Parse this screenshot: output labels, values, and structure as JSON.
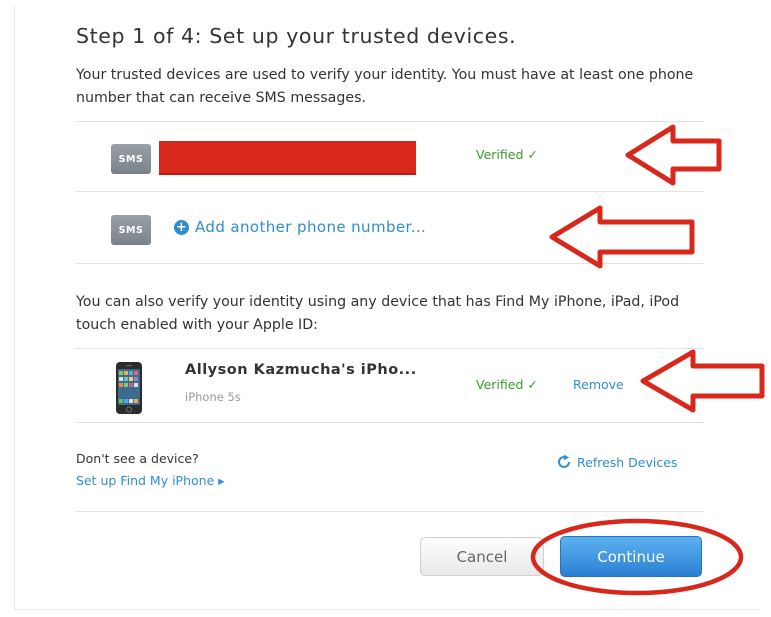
{
  "header": {
    "title": "Step 1 of 4: Set up your trusted devices.",
    "intro": "Your trusted devices are used to verify your identity. You must have at least one phone number that can receive SMS messages."
  },
  "sms_devices": {
    "badge_label": "SMS",
    "verified_label": "Verified ✓",
    "add_label": "Add another phone number..."
  },
  "find_my": {
    "description": "You can also verify your identity using any device that has Find My iPhone, iPad, iPod touch enabled with your Apple ID:",
    "device_name": "Allyson Kazmucha's iPho...",
    "device_model": "iPhone 5s",
    "verified_label": "Verified ✓",
    "remove_label": "Remove"
  },
  "footer": {
    "dont_see": "Don't see a device?",
    "setup_link": "Set up Find My iPhone ▸",
    "refresh_label": "Refresh Devices",
    "cancel_label": "Cancel",
    "continue_label": "Continue"
  },
  "colors": {
    "annotation_red": "#d8271b",
    "link_blue": "#2f8ec9",
    "verified_green": "#3a9a2a"
  },
  "icons": [
    "add-circle-icon",
    "refresh-icon",
    "iphone-icon",
    "arrow-annotation-icon",
    "ellipse-annotation-icon"
  ]
}
